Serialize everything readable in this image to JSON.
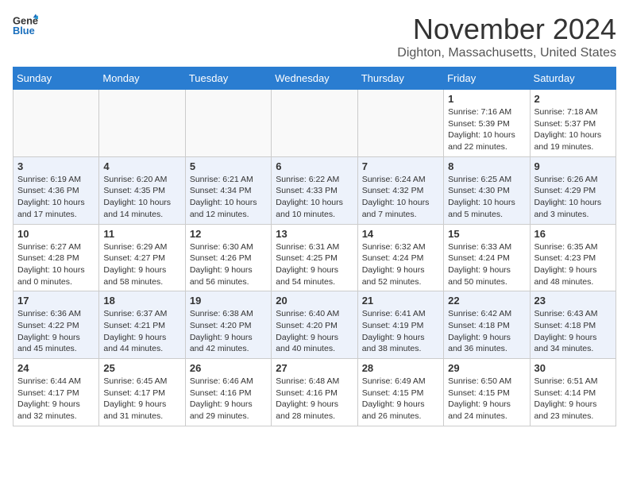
{
  "header": {
    "logo_general": "General",
    "logo_blue": "Blue",
    "month_title": "November 2024",
    "location": "Dighton, Massachusetts, United States"
  },
  "weekdays": [
    "Sunday",
    "Monday",
    "Tuesday",
    "Wednesday",
    "Thursday",
    "Friday",
    "Saturday"
  ],
  "weeks": [
    {
      "days": [
        {
          "num": "",
          "info": ""
        },
        {
          "num": "",
          "info": ""
        },
        {
          "num": "",
          "info": ""
        },
        {
          "num": "",
          "info": ""
        },
        {
          "num": "",
          "info": ""
        },
        {
          "num": "1",
          "info": "Sunrise: 7:16 AM\nSunset: 5:39 PM\nDaylight: 10 hours\nand 22 minutes."
        },
        {
          "num": "2",
          "info": "Sunrise: 7:18 AM\nSunset: 5:37 PM\nDaylight: 10 hours\nand 19 minutes."
        }
      ]
    },
    {
      "days": [
        {
          "num": "3",
          "info": "Sunrise: 6:19 AM\nSunset: 4:36 PM\nDaylight: 10 hours\nand 17 minutes."
        },
        {
          "num": "4",
          "info": "Sunrise: 6:20 AM\nSunset: 4:35 PM\nDaylight: 10 hours\nand 14 minutes."
        },
        {
          "num": "5",
          "info": "Sunrise: 6:21 AM\nSunset: 4:34 PM\nDaylight: 10 hours\nand 12 minutes."
        },
        {
          "num": "6",
          "info": "Sunrise: 6:22 AM\nSunset: 4:33 PM\nDaylight: 10 hours\nand 10 minutes."
        },
        {
          "num": "7",
          "info": "Sunrise: 6:24 AM\nSunset: 4:32 PM\nDaylight: 10 hours\nand 7 minutes."
        },
        {
          "num": "8",
          "info": "Sunrise: 6:25 AM\nSunset: 4:30 PM\nDaylight: 10 hours\nand 5 minutes."
        },
        {
          "num": "9",
          "info": "Sunrise: 6:26 AM\nSunset: 4:29 PM\nDaylight: 10 hours\nand 3 minutes."
        }
      ]
    },
    {
      "days": [
        {
          "num": "10",
          "info": "Sunrise: 6:27 AM\nSunset: 4:28 PM\nDaylight: 10 hours\nand 0 minutes."
        },
        {
          "num": "11",
          "info": "Sunrise: 6:29 AM\nSunset: 4:27 PM\nDaylight: 9 hours\nand 58 minutes."
        },
        {
          "num": "12",
          "info": "Sunrise: 6:30 AM\nSunset: 4:26 PM\nDaylight: 9 hours\nand 56 minutes."
        },
        {
          "num": "13",
          "info": "Sunrise: 6:31 AM\nSunset: 4:25 PM\nDaylight: 9 hours\nand 54 minutes."
        },
        {
          "num": "14",
          "info": "Sunrise: 6:32 AM\nSunset: 4:24 PM\nDaylight: 9 hours\nand 52 minutes."
        },
        {
          "num": "15",
          "info": "Sunrise: 6:33 AM\nSunset: 4:24 PM\nDaylight: 9 hours\nand 50 minutes."
        },
        {
          "num": "16",
          "info": "Sunrise: 6:35 AM\nSunset: 4:23 PM\nDaylight: 9 hours\nand 48 minutes."
        }
      ]
    },
    {
      "days": [
        {
          "num": "17",
          "info": "Sunrise: 6:36 AM\nSunset: 4:22 PM\nDaylight: 9 hours\nand 45 minutes."
        },
        {
          "num": "18",
          "info": "Sunrise: 6:37 AM\nSunset: 4:21 PM\nDaylight: 9 hours\nand 44 minutes."
        },
        {
          "num": "19",
          "info": "Sunrise: 6:38 AM\nSunset: 4:20 PM\nDaylight: 9 hours\nand 42 minutes."
        },
        {
          "num": "20",
          "info": "Sunrise: 6:40 AM\nSunset: 4:20 PM\nDaylight: 9 hours\nand 40 minutes."
        },
        {
          "num": "21",
          "info": "Sunrise: 6:41 AM\nSunset: 4:19 PM\nDaylight: 9 hours\nand 38 minutes."
        },
        {
          "num": "22",
          "info": "Sunrise: 6:42 AM\nSunset: 4:18 PM\nDaylight: 9 hours\nand 36 minutes."
        },
        {
          "num": "23",
          "info": "Sunrise: 6:43 AM\nSunset: 4:18 PM\nDaylight: 9 hours\nand 34 minutes."
        }
      ]
    },
    {
      "days": [
        {
          "num": "24",
          "info": "Sunrise: 6:44 AM\nSunset: 4:17 PM\nDaylight: 9 hours\nand 32 minutes."
        },
        {
          "num": "25",
          "info": "Sunrise: 6:45 AM\nSunset: 4:17 PM\nDaylight: 9 hours\nand 31 minutes."
        },
        {
          "num": "26",
          "info": "Sunrise: 6:46 AM\nSunset: 4:16 PM\nDaylight: 9 hours\nand 29 minutes."
        },
        {
          "num": "27",
          "info": "Sunrise: 6:48 AM\nSunset: 4:16 PM\nDaylight: 9 hours\nand 28 minutes."
        },
        {
          "num": "28",
          "info": "Sunrise: 6:49 AM\nSunset: 4:15 PM\nDaylight: 9 hours\nand 26 minutes."
        },
        {
          "num": "29",
          "info": "Sunrise: 6:50 AM\nSunset: 4:15 PM\nDaylight: 9 hours\nand 24 minutes."
        },
        {
          "num": "30",
          "info": "Sunrise: 6:51 AM\nSunset: 4:14 PM\nDaylight: 9 hours\nand 23 minutes."
        }
      ]
    }
  ]
}
